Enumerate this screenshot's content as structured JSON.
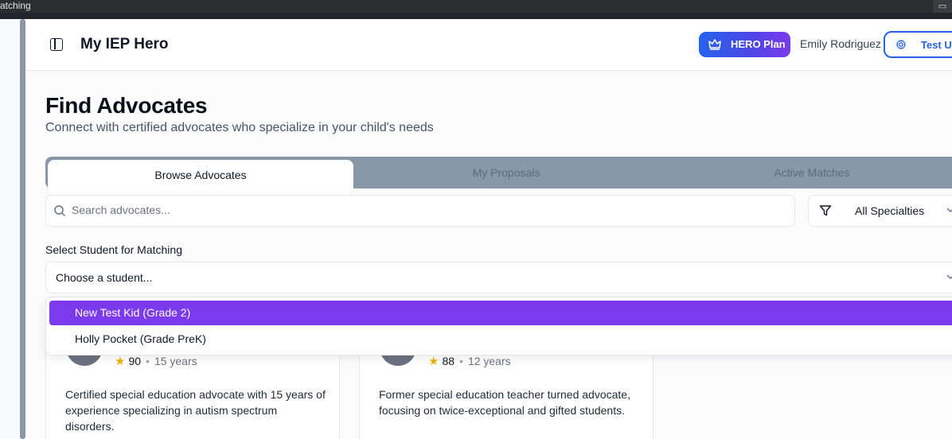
{
  "browser": {
    "tab_title": "atching",
    "device_icon": "device-toggle-icon"
  },
  "header": {
    "app_title": "My IEP Hero",
    "plan_button": "HERO Plan",
    "user_name": "Emily Rodriguez",
    "test_button": "Test Us"
  },
  "page": {
    "title": "Find Advocates",
    "subtitle": "Connect with certified advocates who specialize in your child's needs"
  },
  "tabs": [
    {
      "label": "Browse Advocates",
      "active": true
    },
    {
      "label": "My Proposals",
      "active": false
    },
    {
      "label": "Active Matches",
      "active": false
    }
  ],
  "search": {
    "placeholder": "Search advocates..."
  },
  "filter": {
    "label": "All Specialties"
  },
  "student_select": {
    "label": "Select Student for Matching",
    "value": "Choose a student...",
    "options": [
      "New Test Kid (Grade 2)",
      "Holly Pocket (Grade PreK)"
    ],
    "highlighted_index": 0
  },
  "cards": [
    {
      "rating": "90",
      "experience": "15 years",
      "description": "Certified special education advocate with 15 years of experience specializing in autism spectrum disorders."
    },
    {
      "rating": "88",
      "experience": "12 years",
      "description": "Former special education teacher turned advocate, focusing on twice-exceptional and gifted students."
    }
  ],
  "colors": {
    "accent": "#7c3aed",
    "primary": "#2563eb",
    "star": "#eab308"
  }
}
